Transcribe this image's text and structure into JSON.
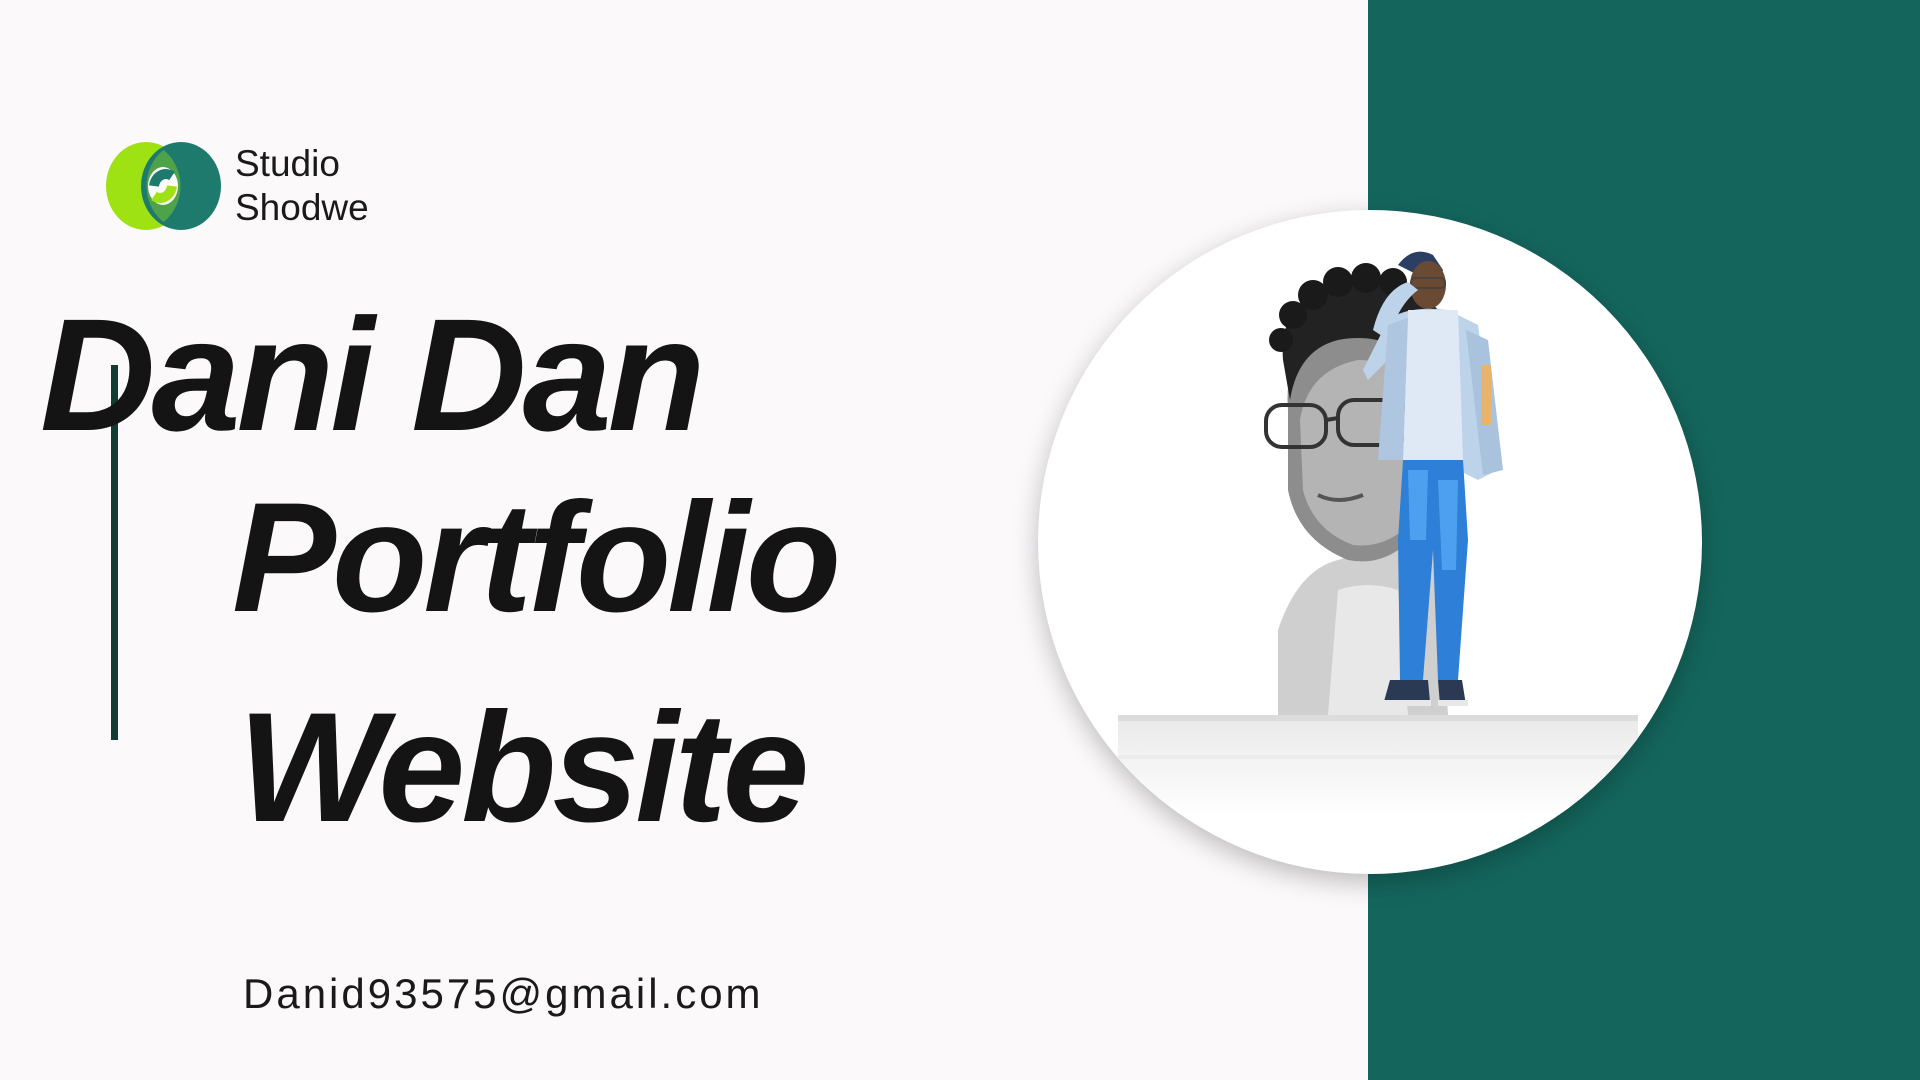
{
  "brand": {
    "line1": "Studio",
    "line2": "Shodwe",
    "logo_icon": "interlocking-rings-logo-icon",
    "colors": {
      "logo_lime": "#9fe214",
      "logo_teal": "#1e7a6c",
      "panel_teal": "#14665d",
      "accent_line": "#103c33",
      "background": "#fbf9fa",
      "text": "#141414"
    }
  },
  "hero": {
    "name": "Dani Dan",
    "line2": "Portfolio",
    "line3": "Website"
  },
  "contact": {
    "email": "Danid93575@gmail.com"
  },
  "photo": {
    "icon": "portrait-photo-illustration"
  }
}
